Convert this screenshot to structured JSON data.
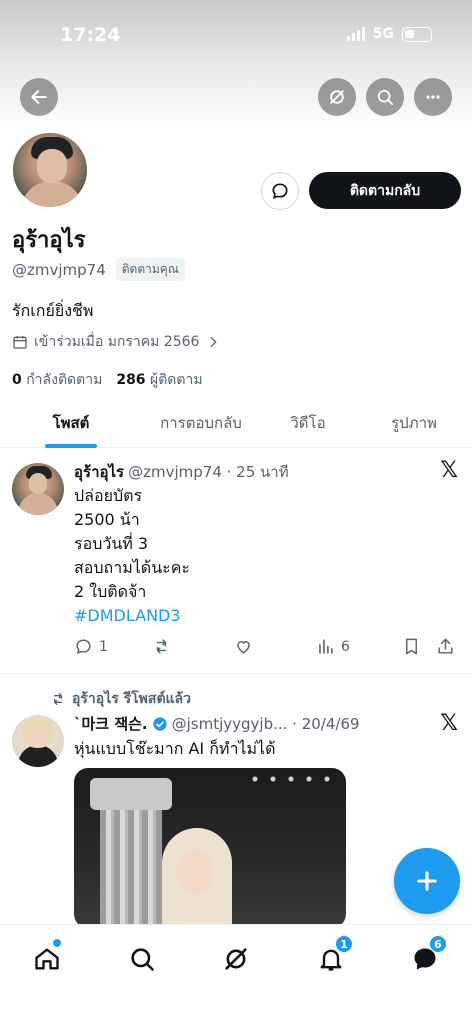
{
  "status_bar": {
    "time": "17:24",
    "network": "5G"
  },
  "header": {
    "back_icon": "back-arrow-icon",
    "grok_icon": "grok-icon",
    "search_icon": "search-icon",
    "more_icon": "more-icon"
  },
  "profile": {
    "display_name": "อุร้าอุไร",
    "handle": "@zmvjmp74",
    "follows_you": "ติดตามคุณ",
    "bio": "รักเกย์ยิ่งชีพ",
    "joined": "เข้าร่วมเมื่อ มกราคม 2566",
    "following_count": "0",
    "following_label": "กำลังติดตาม",
    "followers_count": "286",
    "followers_label": "ผู้ติดตาม",
    "follow_back_label": "ติดตามกลับ"
  },
  "tabs": [
    {
      "label": "โพสต์",
      "active": true
    },
    {
      "label": "การตอบกลับ",
      "active": false
    },
    {
      "label": "วิดีโอ",
      "active": false
    },
    {
      "label": "รูปภาพ",
      "active": false
    }
  ],
  "tweet1": {
    "name": "อุร้าอุไร",
    "handle_time": "@zmvjmp74 · 25 นาที",
    "lines": [
      "ปล่อยบัตร",
      "2500 น้า",
      "รอบวันที่ 3",
      "สอบถามได้นะคะ",
      "2 ใบติดจ้า"
    ],
    "hashtag": "#DMDLAND3",
    "replies": "1",
    "views": "6"
  },
  "tweet2": {
    "reposted_by": "อุร้าอุไร รีโพสต์แล้ว",
    "name": "`마크 잭슨.",
    "handle_time": "@jsmtjyygyjb... · 20/4/69",
    "text": "หุ่นแบบโช๊ะมาก AI ก็ทำไม่ได้"
  },
  "bottom_nav": {
    "notifications_badge": "1",
    "messages_badge": "6"
  },
  "colors": {
    "accent": "#1d9bf0",
    "text": "#0f1419",
    "secondary": "#536471"
  }
}
